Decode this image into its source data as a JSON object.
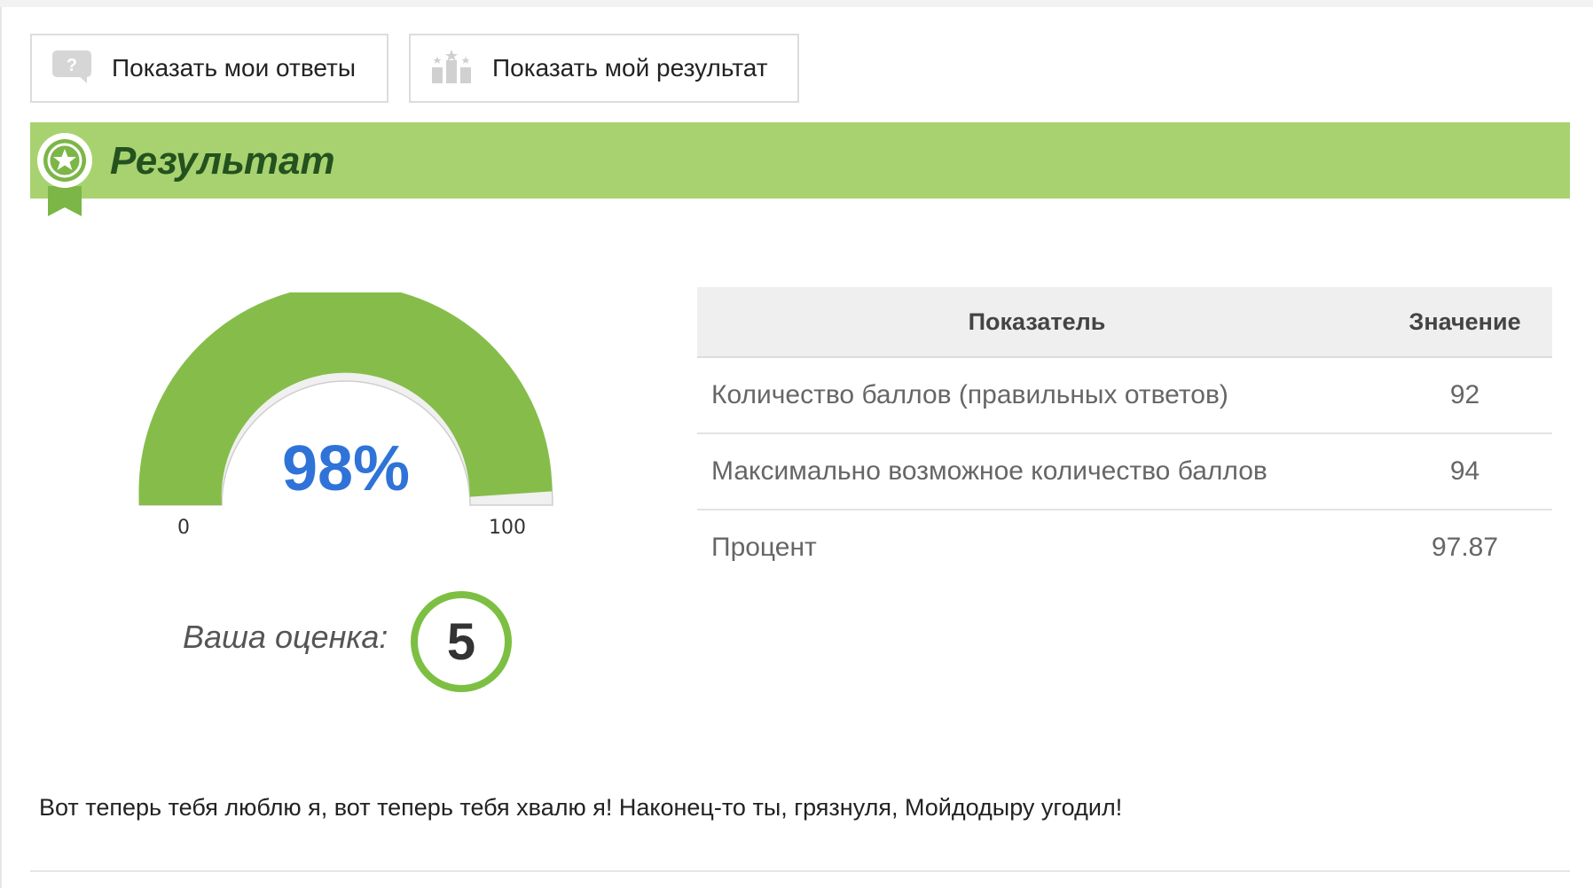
{
  "toolbar": {
    "show_answers_label": "Показать мои ответы",
    "show_result_label": "Показать мой результат"
  },
  "result_section": {
    "title": "Результат",
    "accent_color": "#a8d26f"
  },
  "gauge": {
    "percent_label": "98%",
    "value_percent": 97.87,
    "min_label": "0",
    "max_label": "100",
    "fill_color": "#86bd4a",
    "track_color": "#f0f0f0"
  },
  "grade": {
    "label": "Ваша оценка:",
    "value": "5"
  },
  "stats_table": {
    "headers": [
      "Показатель",
      "Значение"
    ],
    "rows": [
      {
        "metric": "Количество баллов (правильных ответов)",
        "value": "92"
      },
      {
        "metric": "Максимально возможное количество баллов",
        "value": "94"
      },
      {
        "metric": "Процент",
        "value": "97.87"
      }
    ]
  },
  "message": "Вот теперь тебя люблю я, вот теперь тебя хвалю я! Наконец-то ты, грязнуля, Мойдодыру угодил!",
  "icons": {
    "answers": "question-bubble-icon",
    "result": "podium-icon",
    "badge": "award-ribbon-icon"
  }
}
